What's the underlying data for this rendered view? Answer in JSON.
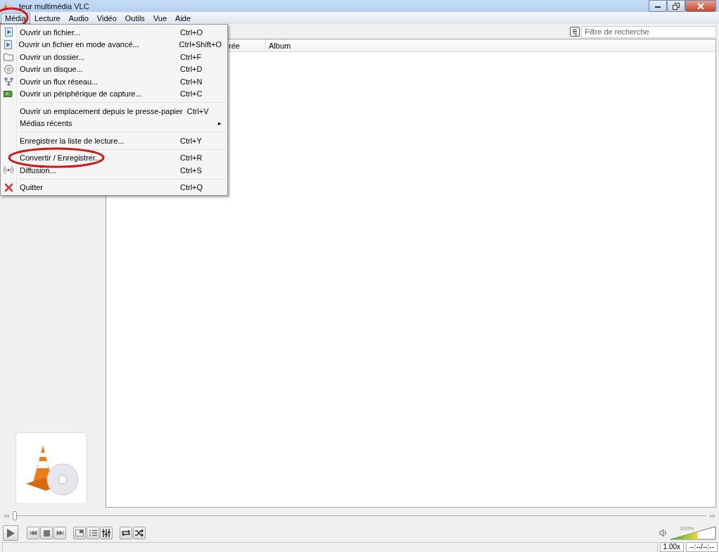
{
  "window": {
    "title": "teur multimédia VLC"
  },
  "menubar": [
    {
      "label": "Média",
      "selected": true,
      "circled": true
    },
    {
      "label": "Lecture",
      "selected": false,
      "circled": false
    },
    {
      "label": "Audio",
      "selected": false,
      "circled": false
    },
    {
      "label": "Vidéo",
      "selected": false,
      "circled": false
    },
    {
      "label": "Outils",
      "selected": false,
      "circled": false
    },
    {
      "label": "Vue",
      "selected": false,
      "circled": false
    },
    {
      "label": "Aide",
      "selected": false,
      "circled": false
    }
  ],
  "media_menu": [
    {
      "kind": "item",
      "label": "Ouvrir un fichier...",
      "shortcut": "Ctrl+O",
      "circled": false
    },
    {
      "kind": "item",
      "label": "Ouvrir un fichier en mode avancé...",
      "shortcut": "Ctrl+Shift+O",
      "circled": false
    },
    {
      "kind": "item",
      "label": "Ouvrir un dossier...",
      "shortcut": "Ctrl+F",
      "circled": false
    },
    {
      "kind": "item",
      "label": "Ouvrir un disque...",
      "shortcut": "Ctrl+D",
      "circled": false
    },
    {
      "kind": "item",
      "label": "Ouvrir un flux réseau...",
      "shortcut": "Ctrl+N",
      "circled": false
    },
    {
      "kind": "item",
      "label": "Ouvrir un périphérique de capture...",
      "shortcut": "Ctrl+C",
      "circled": false
    },
    {
      "kind": "separator"
    },
    {
      "kind": "item",
      "label": "Ouvrir un emplacement depuis le presse-papier",
      "shortcut": "Ctrl+V",
      "circled": false
    },
    {
      "kind": "submenu",
      "label": "Médias récents",
      "arrow": "▸"
    },
    {
      "kind": "separator"
    },
    {
      "kind": "item",
      "label": "Enregistrer la liste de lecture...",
      "shortcut": "Ctrl+Y",
      "circled": false
    },
    {
      "kind": "separator"
    },
    {
      "kind": "item",
      "label": "Convertir / Enregistrer...",
      "shortcut": "Ctrl+R",
      "circled": true
    },
    {
      "kind": "item",
      "label": "Diffusion...",
      "shortcut": "Ctrl+S",
      "circled": false
    },
    {
      "kind": "separator"
    },
    {
      "kind": "item",
      "label": "Quitter",
      "shortcut": "Ctrl+Q",
      "circled": false
    }
  ],
  "search": {
    "placeholder": "Filtre de recherche"
  },
  "playlist": {
    "columns": [
      "rée",
      "Album"
    ]
  },
  "seek": {
    "level": 0
  },
  "volume": {
    "level": 0.6,
    "reading": "100%"
  },
  "status_bar": {
    "speed": "1.00x",
    "time": "--:--/--:--"
  }
}
